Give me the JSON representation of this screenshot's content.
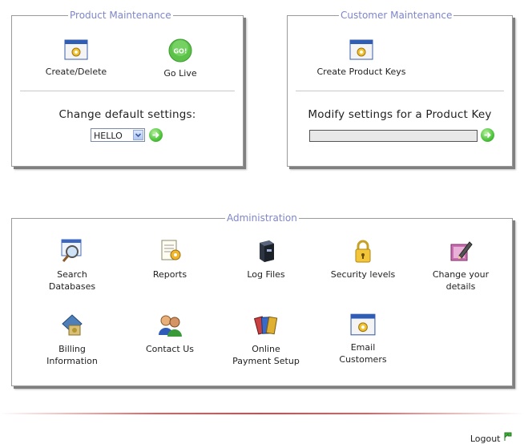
{
  "product_maintenance": {
    "title": "Product Maintenance",
    "create_delete": "Create/Delete",
    "go_live": "Go Live",
    "go_badge": "GO!",
    "change_default": "Change default settings:",
    "select_value": "HELLO"
  },
  "customer_maintenance": {
    "title": "Customer Maintenance",
    "create_keys": "Create Product Keys",
    "modify_settings": "Modify settings for a Product Key",
    "key_value": ""
  },
  "administration": {
    "title": "Administration",
    "items": [
      {
        "label": "Search\nDatabases",
        "icon": "search-database-icon"
      },
      {
        "label": "Reports",
        "icon": "reports-icon"
      },
      {
        "label": "Log Files",
        "icon": "log-files-icon"
      },
      {
        "label": "Security levels",
        "icon": "lock-icon"
      },
      {
        "label": "Change your\ndetails",
        "icon": "edit-details-icon"
      },
      {
        "label": "Billing\nInformation",
        "icon": "billing-icon"
      },
      {
        "label": "Contact Us",
        "icon": "contacts-icon"
      },
      {
        "label": "Online\nPayment Setup",
        "icon": "payment-cards-icon"
      },
      {
        "label": "Email\nCustomers",
        "icon": "window-icon"
      }
    ]
  },
  "logout": "Logout",
  "colors": {
    "legend": "#7f86c9",
    "go_green": "#4cc33a",
    "divider": "#d84848"
  }
}
